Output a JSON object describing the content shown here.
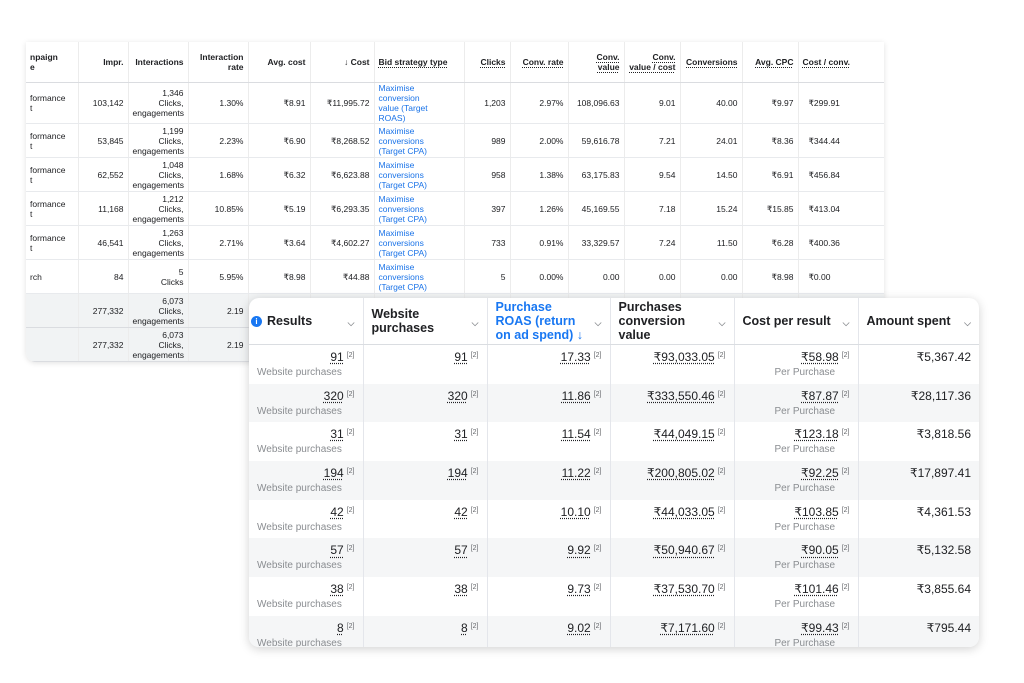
{
  "gads": {
    "headers": {
      "campaign": "npaign\ne",
      "impr": "Impr.",
      "interactions": "Interactions",
      "interaction_rate": "Interaction rate",
      "avg_cost": "Avg. cost",
      "cost": "↓ Cost",
      "bid_strategy": "Bid strategy type",
      "clicks": "Clicks",
      "conv_rate": "Conv. rate",
      "conv_value": "Conv. value",
      "conv_value_cost": "Conv. value / cost",
      "conversions": "Conversions",
      "avg_cpc": "Avg. CPC",
      "cost_conv": "Cost / conv."
    },
    "rows": [
      {
        "campaign": "formance\nt",
        "impr": "103,142",
        "interactions": "1,346\nClicks,\nengagements",
        "interaction_rate": "1.30%",
        "avg_cost": "₹8.91",
        "cost": "₹11,995.72",
        "bid": "Maximise\nconversion\nvalue (Target\nROAS)",
        "clicks": "1,203",
        "conv_rate": "2.97%",
        "conv_value": "108,096.63",
        "conv_value_cost": "9.01",
        "conversions": "40.00",
        "avg_cpc": "₹9.97",
        "cost_conv": "₹299.91"
      },
      {
        "campaign": "formance\nt",
        "impr": "53,845",
        "interactions": "1,199\nClicks,\nengagements",
        "interaction_rate": "2.23%",
        "avg_cost": "₹6.90",
        "cost": "₹8,268.52",
        "bid": "Maximise\nconversions\n(Target CPA)",
        "clicks": "989",
        "conv_rate": "2.00%",
        "conv_value": "59,616.78",
        "conv_value_cost": "7.21",
        "conversions": "24.01",
        "avg_cpc": "₹8.36",
        "cost_conv": "₹344.44"
      },
      {
        "campaign": "formance\nt",
        "impr": "62,552",
        "interactions": "1,048\nClicks,\nengagements",
        "interaction_rate": "1.68%",
        "avg_cost": "₹6.32",
        "cost": "₹6,623.88",
        "bid": "Maximise\nconversions\n(Target CPA)",
        "clicks": "958",
        "conv_rate": "1.38%",
        "conv_value": "63,175.83",
        "conv_value_cost": "9.54",
        "conversions": "14.50",
        "avg_cpc": "₹6.91",
        "cost_conv": "₹456.84"
      },
      {
        "campaign": "formance\nt",
        "impr": "11,168",
        "interactions": "1,212\nClicks,\nengagements",
        "interaction_rate": "10.85%",
        "avg_cost": "₹5.19",
        "cost": "₹6,293.35",
        "bid": "Maximise\nconversions\n(Target CPA)",
        "clicks": "397",
        "conv_rate": "1.26%",
        "conv_value": "45,169.55",
        "conv_value_cost": "7.18",
        "conversions": "15.24",
        "avg_cpc": "₹15.85",
        "cost_conv": "₹413.04"
      },
      {
        "campaign": "formance\nt",
        "impr": "46,541",
        "interactions": "1,263\nClicks,\nengagements",
        "interaction_rate": "2.71%",
        "avg_cost": "₹3.64",
        "cost": "₹4,602.27",
        "bid": "Maximise\nconversions\n(Target CPA)",
        "clicks": "733",
        "conv_rate": "0.91%",
        "conv_value": "33,329.57",
        "conv_value_cost": "7.24",
        "conversions": "11.50",
        "avg_cpc": "₹6.28",
        "cost_conv": "₹400.36"
      },
      {
        "campaign": "rch",
        "impr": "84",
        "interactions": "5\nClicks",
        "interaction_rate": "5.95%",
        "avg_cost": "₹8.98",
        "cost": "₹44.88",
        "bid": "Maximise\nconversions\n(Target CPA)",
        "clicks": "5",
        "conv_rate": "0.00%",
        "conv_value": "0.00",
        "conv_value_cost": "0.00",
        "conversions": "0.00",
        "avg_cpc": "₹8.98",
        "cost_conv": "₹0.00"
      }
    ],
    "totals": [
      {
        "impr": "277,332",
        "interactions": "6,073\nClicks,\nengagements",
        "interaction_rate": "2.19"
      },
      {
        "impr": "277,332",
        "interactions": "6,073\nClicks,\nengagements",
        "interaction_rate": "2.19"
      }
    ]
  },
  "meta": {
    "headers": {
      "results": "Results",
      "website_purchases": "Website purchases",
      "roas": "Purchase ROAS (return on ad spend) ↓",
      "conv_value": "Purchases conversion value",
      "cost_per_result": "Cost per result",
      "amount_spent": "Amount spent"
    },
    "footnote_marker": "[2]",
    "results_sublabel": "Website purchases",
    "cpr_sublabel": "Per Purchase",
    "rows": [
      {
        "results": "91",
        "purchases": "91",
        "roas": "17.33",
        "conv_value": "₹93,033.05",
        "cpr": "₹58.98",
        "spent": "₹5,367.42"
      },
      {
        "results": "320",
        "purchases": "320",
        "roas": "11.86",
        "conv_value": "₹333,550.46",
        "cpr": "₹87.87",
        "spent": "₹28,117.36"
      },
      {
        "results": "31",
        "purchases": "31",
        "roas": "11.54",
        "conv_value": "₹44,049.15",
        "cpr": "₹123.18",
        "spent": "₹3,818.56"
      },
      {
        "results": "194",
        "purchases": "194",
        "roas": "11.22",
        "conv_value": "₹200,805.02",
        "cpr": "₹92.25",
        "spent": "₹17,897.41"
      },
      {
        "results": "42",
        "purchases": "42",
        "roas": "10.10",
        "conv_value": "₹44,033.05",
        "cpr": "₹103.85",
        "spent": "₹4,361.53"
      },
      {
        "results": "57",
        "purchases": "57",
        "roas": "9.92",
        "conv_value": "₹50,940.67",
        "cpr": "₹90.05",
        "spent": "₹5,132.58"
      },
      {
        "results": "38",
        "purchases": "38",
        "roas": "9.73",
        "conv_value": "₹37,530.70",
        "cpr": "₹101.46",
        "spent": "₹3,855.64"
      },
      {
        "results": "8",
        "purchases": "8",
        "roas": "9.02",
        "conv_value": "₹7,171.60",
        "cpr": "₹99.43",
        "spent": "₹795.44"
      }
    ]
  },
  "colors": {
    "meta_accent": "#1877f2",
    "gads_link": "#1a73e8",
    "row_alt": "#f5f6f7"
  }
}
